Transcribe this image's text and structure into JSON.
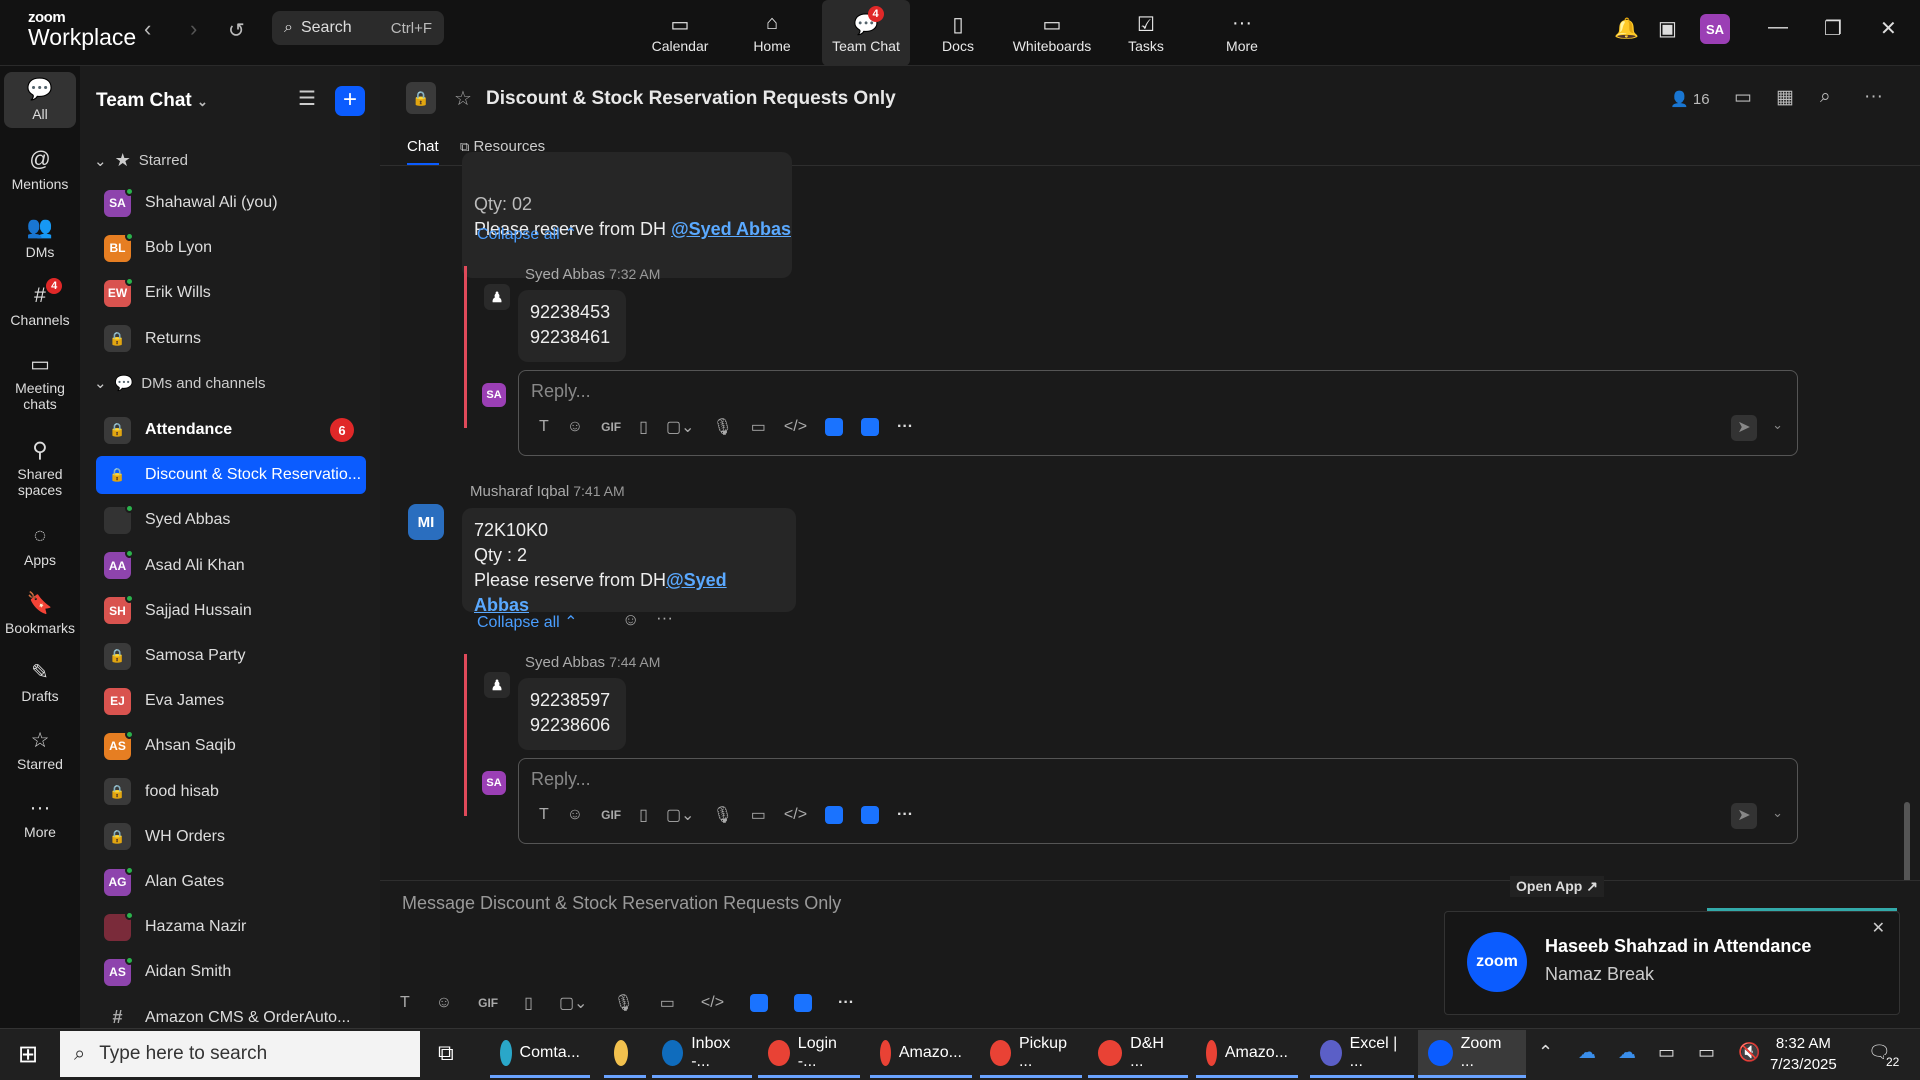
{
  "app": {
    "brand_top": "zoom",
    "brand_bottom": "Workplace"
  },
  "search": {
    "placeholder": "Search",
    "shortcut": "Ctrl+F"
  },
  "topnav": [
    {
      "label": "Calendar",
      "icon": "calendar-icon"
    },
    {
      "label": "Home",
      "icon": "home-icon"
    },
    {
      "label": "Team Chat",
      "icon": "chat-icon",
      "badge": "4",
      "active": true
    },
    {
      "label": "Docs",
      "icon": "docs-icon"
    },
    {
      "label": "Whiteboards",
      "icon": "whiteboard-icon"
    },
    {
      "label": "Tasks",
      "icon": "tasks-icon"
    },
    {
      "label": "More",
      "icon": "more-icon"
    }
  ],
  "user": {
    "initials": "SA",
    "avatar_color": "#9b3fb5"
  },
  "rail": [
    {
      "label": "All",
      "icon": "chat-bubble-icon",
      "active": true
    },
    {
      "label": "Mentions",
      "icon": "at-icon"
    },
    {
      "label": "DMs",
      "icon": "people-icon"
    },
    {
      "label": "Channels",
      "icon": "hash-icon",
      "badge": "4"
    },
    {
      "label": "Meeting chats",
      "icon": "meeting-chat-icon"
    },
    {
      "label": "Shared spaces",
      "icon": "shared-spaces-icon"
    },
    {
      "label": "Apps",
      "icon": "apps-icon"
    },
    {
      "label": "Bookmarks",
      "icon": "bookmark-icon"
    },
    {
      "label": "Drafts",
      "icon": "drafts-icon"
    },
    {
      "label": "Starred",
      "icon": "star-icon"
    },
    {
      "label": "More",
      "icon": "more-icon"
    }
  ],
  "sidebar": {
    "title": "Team Chat",
    "starred_label": "Starred",
    "dms_label": "DMs and channels",
    "starred": [
      {
        "name": "Shahawal Ali (you)",
        "initials": "SA",
        "color": "#8e44ad",
        "online": true
      },
      {
        "name": "Bob Lyon",
        "initials": "BL",
        "color": "#e67e22",
        "online": true
      },
      {
        "name": "Erik Wills",
        "initials": "EW",
        "color": "#d9534f",
        "online": true
      },
      {
        "name": "Returns",
        "lock": true
      }
    ],
    "channels": [
      {
        "name": "Attendance",
        "lock": true,
        "bold": true,
        "count": "6"
      },
      {
        "name": "Discount & Stock Reservatio...",
        "lock": true,
        "active": true
      },
      {
        "name": "Syed Abbas",
        "initials": "",
        "color": "#333333",
        "online": true
      },
      {
        "name": "Asad Ali Khan",
        "initials": "AA",
        "color": "#8e44ad",
        "online": true
      },
      {
        "name": "Sajjad Hussain",
        "initials": "SH",
        "color": "#d9534f",
        "online": true
      },
      {
        "name": "Samosa Party",
        "lock": true
      },
      {
        "name": "Eva James",
        "initials": "EJ",
        "color": "#d9534f",
        "online": false
      },
      {
        "name": "Ahsan Saqib",
        "initials": "AS",
        "color": "#e67e22",
        "online": true
      },
      {
        "name": "food hisab",
        "lock": true
      },
      {
        "name": "WH Orders",
        "lock": true
      },
      {
        "name": "Alan Gates",
        "initials": "AG",
        "color": "#8e44ad",
        "online": true
      },
      {
        "name": "Hazama Nazir",
        "initials": "",
        "color": "#7a2b3a",
        "online": true
      },
      {
        "name": "Aidan Smith",
        "initials": "AS",
        "color": "#8e44ad",
        "online": true
      },
      {
        "name": "Amazon CMS & OrderAuto...",
        "hash": true
      }
    ]
  },
  "channel": {
    "title": "Discount & Stock Reservation Requests Only",
    "tabs": [
      "Chat",
      "Resources"
    ],
    "members": "16"
  },
  "messages": {
    "partial_line1": "Qty: 02",
    "partial_line2": "Please reserve from DH ",
    "partial_mention": "@Syed Abbas",
    "collapse_label": "Collapse all",
    "reply1": {
      "author": "Syed Abbas",
      "time": "7:32 AM",
      "lines": [
        "92238453",
        "92238461"
      ]
    },
    "reply_placeholder": "Reply...",
    "msg2": {
      "author": "Musharaf Iqbal",
      "time": "7:41 AM",
      "initials": "MI",
      "line1": "72K10K0",
      "line2": "Qty : 2",
      "line3": "Please reserve from DH",
      "mention": "@Syed Abbas"
    },
    "reply2": {
      "author": "Syed Abbas",
      "time": "7:44 AM",
      "lines": [
        "92238597",
        "92238606"
      ]
    }
  },
  "composer": {
    "placeholder": "Message Discount & Stock Reservation Requests Only",
    "open_app": "Open App ↗"
  },
  "toast": {
    "logo": "zoom",
    "title": "Haseeb Shahzad in Attendance",
    "body": "Namaz Break"
  },
  "taskbar": {
    "search_placeholder": "Type here to search",
    "apps": [
      {
        "label": "Comta...",
        "color": "#2aa7c9"
      },
      {
        "label": "",
        "color": "#f2c14e"
      },
      {
        "label": "Inbox -...",
        "color": "#0f6cbd"
      },
      {
        "label": "Login -...",
        "color": "#e94235"
      },
      {
        "label": "Amazo...",
        "color": "#e94235"
      },
      {
        "label": "Pickup ...",
        "color": "#e94235"
      },
      {
        "label": "D&H ...",
        "color": "#e94235"
      },
      {
        "label": "Amazo...",
        "color": "#e94235"
      },
      {
        "label": "Excel | ...",
        "color": "#5b5fc7"
      },
      {
        "label": "Zoom ...",
        "color": "#0b5cff"
      }
    ],
    "time": "8:32 AM",
    "date": "7/23/2025",
    "notif_count": "22"
  }
}
